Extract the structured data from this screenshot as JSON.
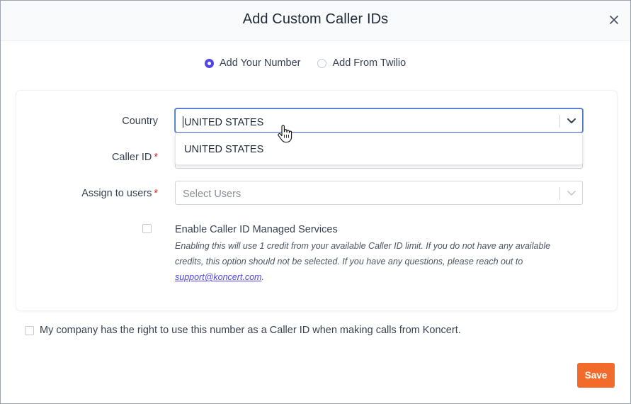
{
  "modal": {
    "title": "Add Custom Caller IDs",
    "close_icon": "close-icon"
  },
  "source_options": [
    {
      "label": "Add Your Number",
      "selected": true
    },
    {
      "label": "Add From Twilio",
      "selected": false
    }
  ],
  "form": {
    "country": {
      "label": "Country",
      "value": "UNITED STATES",
      "dropdown_options": [
        "UNITED STATES"
      ]
    },
    "caller_id": {
      "label": "Caller ID",
      "required_mark": "*"
    },
    "assign_users": {
      "label": "Assign to users",
      "required_mark": "*",
      "placeholder": "Select Users"
    },
    "managed_services": {
      "label": "Enable Caller ID Managed Services",
      "checked": false,
      "description": "Enabling this will use 1 credit from your available Caller ID limit. If you do not have any available credits, this option should not be selected. If you have any questions, please reach out to ",
      "support_link": "support@koncert.com",
      "description_end": "."
    }
  },
  "company_consent": {
    "label": "My company has the right to use this number as a Caller ID when making calls from Koncert.",
    "checked": false
  },
  "actions": {
    "save_label": "Save"
  },
  "colors": {
    "accent": "#4f46e5",
    "save_button": "#f26b2a",
    "required": "#dc2626"
  }
}
